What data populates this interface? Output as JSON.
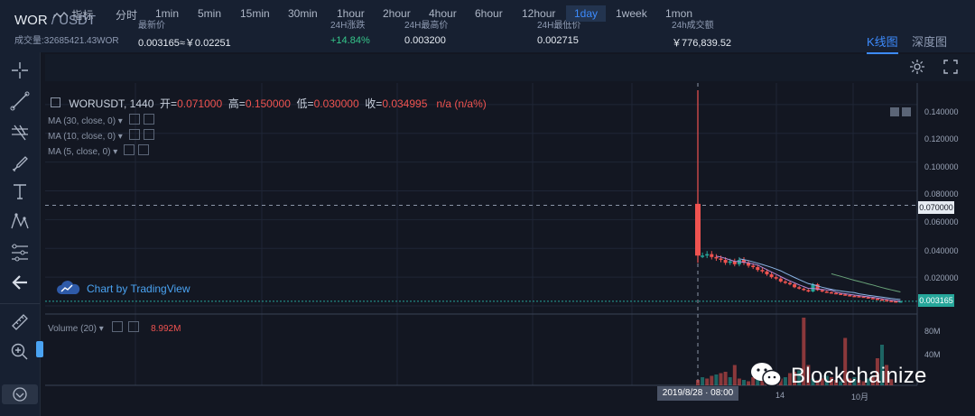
{
  "header": {
    "base": "WOR",
    "sep": "/",
    "quote": "USDT",
    "volume_line": "成交量:32685421.43WOR",
    "stats": [
      {
        "label": "最新价",
        "value": "0.003165≈￥0.02251"
      },
      {
        "label": "24H涨跌",
        "value": "+14.84%"
      },
      {
        "label": "24H最高价",
        "value": "0.003200"
      },
      {
        "label": "24H最低价",
        "value": "0.002715"
      },
      {
        "label": "24h成交额",
        "value": "￥776,839.52"
      }
    ],
    "view_tabs": [
      "K线图",
      "深度图"
    ],
    "active_view": "K线图"
  },
  "toolbar": {
    "indicator_label": "指标",
    "intervals": [
      "分时",
      "1min",
      "5min",
      "15min",
      "30min",
      "1hour",
      "2hour",
      "4hour",
      "6hour",
      "12hour",
      "1day",
      "1week",
      "1mon"
    ],
    "active_interval": "1day"
  },
  "left_tools": [
    "crosshair-icon",
    "trend-line-icon",
    "pitchfork-icon",
    "brush-icon",
    "text-tool-icon",
    "pattern-icon",
    "fib-icon",
    "back-arrow-icon",
    "ruler-icon",
    "zoom-in-icon",
    "magnet-icon"
  ],
  "legend": {
    "symbol": "WORUSDT, 1440",
    "open_label": "开=",
    "open": "0.071000",
    "high_label": "高=",
    "high": "0.150000",
    "low_label": "低=",
    "low": "0.030000",
    "close_label": "收=",
    "close": "0.034995",
    "change": "n/a (n/a%)",
    "ma": [
      "MA (30, close, 0)",
      "MA (10, close, 0)",
      "MA (5, close, 0)"
    ]
  },
  "watermark": "Chart by TradingView",
  "volume_legend": {
    "label": "Volume (20)",
    "value": "8.992M"
  },
  "price_axis": {
    "ticks": [
      "0.140000",
      "0.120000",
      "0.100000",
      "0.080000",
      "0.060000",
      "0.040000",
      "0.020000"
    ],
    "open_tag": "0.070000",
    "last_tag": "0.003165"
  },
  "volume_axis": {
    "ticks": [
      "80M",
      "40M"
    ]
  },
  "time_axis": {
    "date_tag": "2019/8/28 · 08:00",
    "ticks": [
      "14",
      "10月"
    ]
  },
  "brand": "Blockchainize",
  "colors": {
    "up": "#26a69a",
    "down": "#ef5350",
    "accent": "#3d8bfd",
    "last_price_bg": "#26a69a"
  },
  "chart_data": {
    "type": "candlestick",
    "interval": "1day",
    "first_bar": {
      "open": 0.071,
      "high": 0.15,
      "low": 0.03,
      "close": 0.034995
    },
    "closes": [
      0.035,
      0.036,
      0.034,
      0.033,
      0.032,
      0.03,
      0.031,
      0.029,
      0.032,
      0.03,
      0.028,
      0.027,
      0.025,
      0.024,
      0.022,
      0.02,
      0.019,
      0.017,
      0.016,
      0.015,
      0.013,
      0.012,
      0.011,
      0.01,
      0.015,
      0.011,
      0.01,
      0.0095,
      0.009,
      0.0085,
      0.008,
      0.0075,
      0.007,
      0.0068,
      0.0065,
      0.006,
      0.0055,
      0.005,
      0.0045,
      0.004,
      0.0035,
      0.0032,
      0.003,
      0.0032
    ],
    "volumes_m": [
      8,
      12,
      10,
      14,
      16,
      18,
      20,
      12,
      30,
      10,
      8,
      6,
      12,
      14,
      10,
      8,
      16,
      14,
      10,
      12,
      18,
      20,
      22,
      100,
      30,
      10,
      8,
      10,
      14,
      12,
      8,
      6,
      70,
      10,
      12,
      8,
      6,
      10,
      12,
      40,
      60,
      30,
      8.992
    ],
    "price_ylim": [
      0,
      0.15
    ],
    "volume_ylim": [
      0,
      100
    ]
  }
}
